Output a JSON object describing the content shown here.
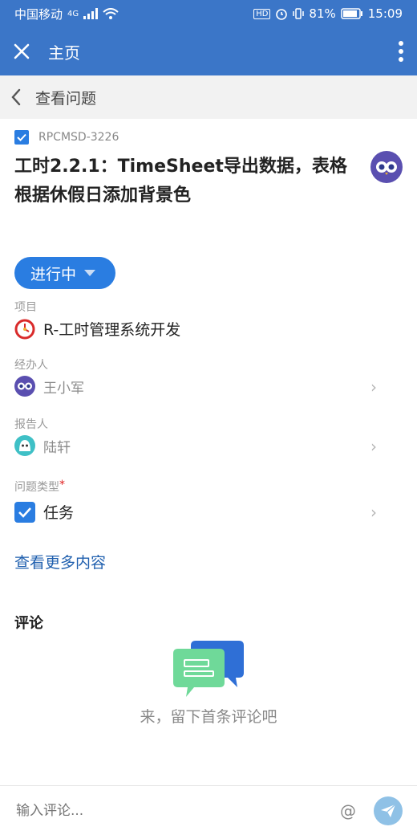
{
  "status_bar": {
    "carrier": "中国移动",
    "network": "4G",
    "battery": "81%",
    "time": "15:09"
  },
  "app_bar": {
    "title": "主页",
    "close_icon": "close-icon",
    "menu_icon": "more-vert-icon"
  },
  "sub_bar": {
    "title": "查看问题",
    "back_icon": "chevron-left-icon"
  },
  "issue": {
    "key": "RPCMSD-3226",
    "title": "工时2.2.1：TimeSheet导出数据，表格根据休假日添加背景色",
    "status": "进行中"
  },
  "fields": {
    "project": {
      "label": "项目",
      "value": "R-工时管理系统开发"
    },
    "assignee": {
      "label": "经办人",
      "value": "王小军"
    },
    "reporter": {
      "label": "报告人",
      "value": "陆轩"
    },
    "issue_type": {
      "label": "问题类型",
      "required": "*",
      "value": "任务"
    }
  },
  "more_link": "查看更多内容",
  "comments": {
    "heading": "评论",
    "empty_text": "来，留下首条评论吧"
  },
  "comment_input": {
    "placeholder": "输入评论...",
    "at": "@"
  },
  "colors": {
    "primary": "#3b76c8",
    "accent": "#2a7de1",
    "link": "#1f5fae"
  }
}
